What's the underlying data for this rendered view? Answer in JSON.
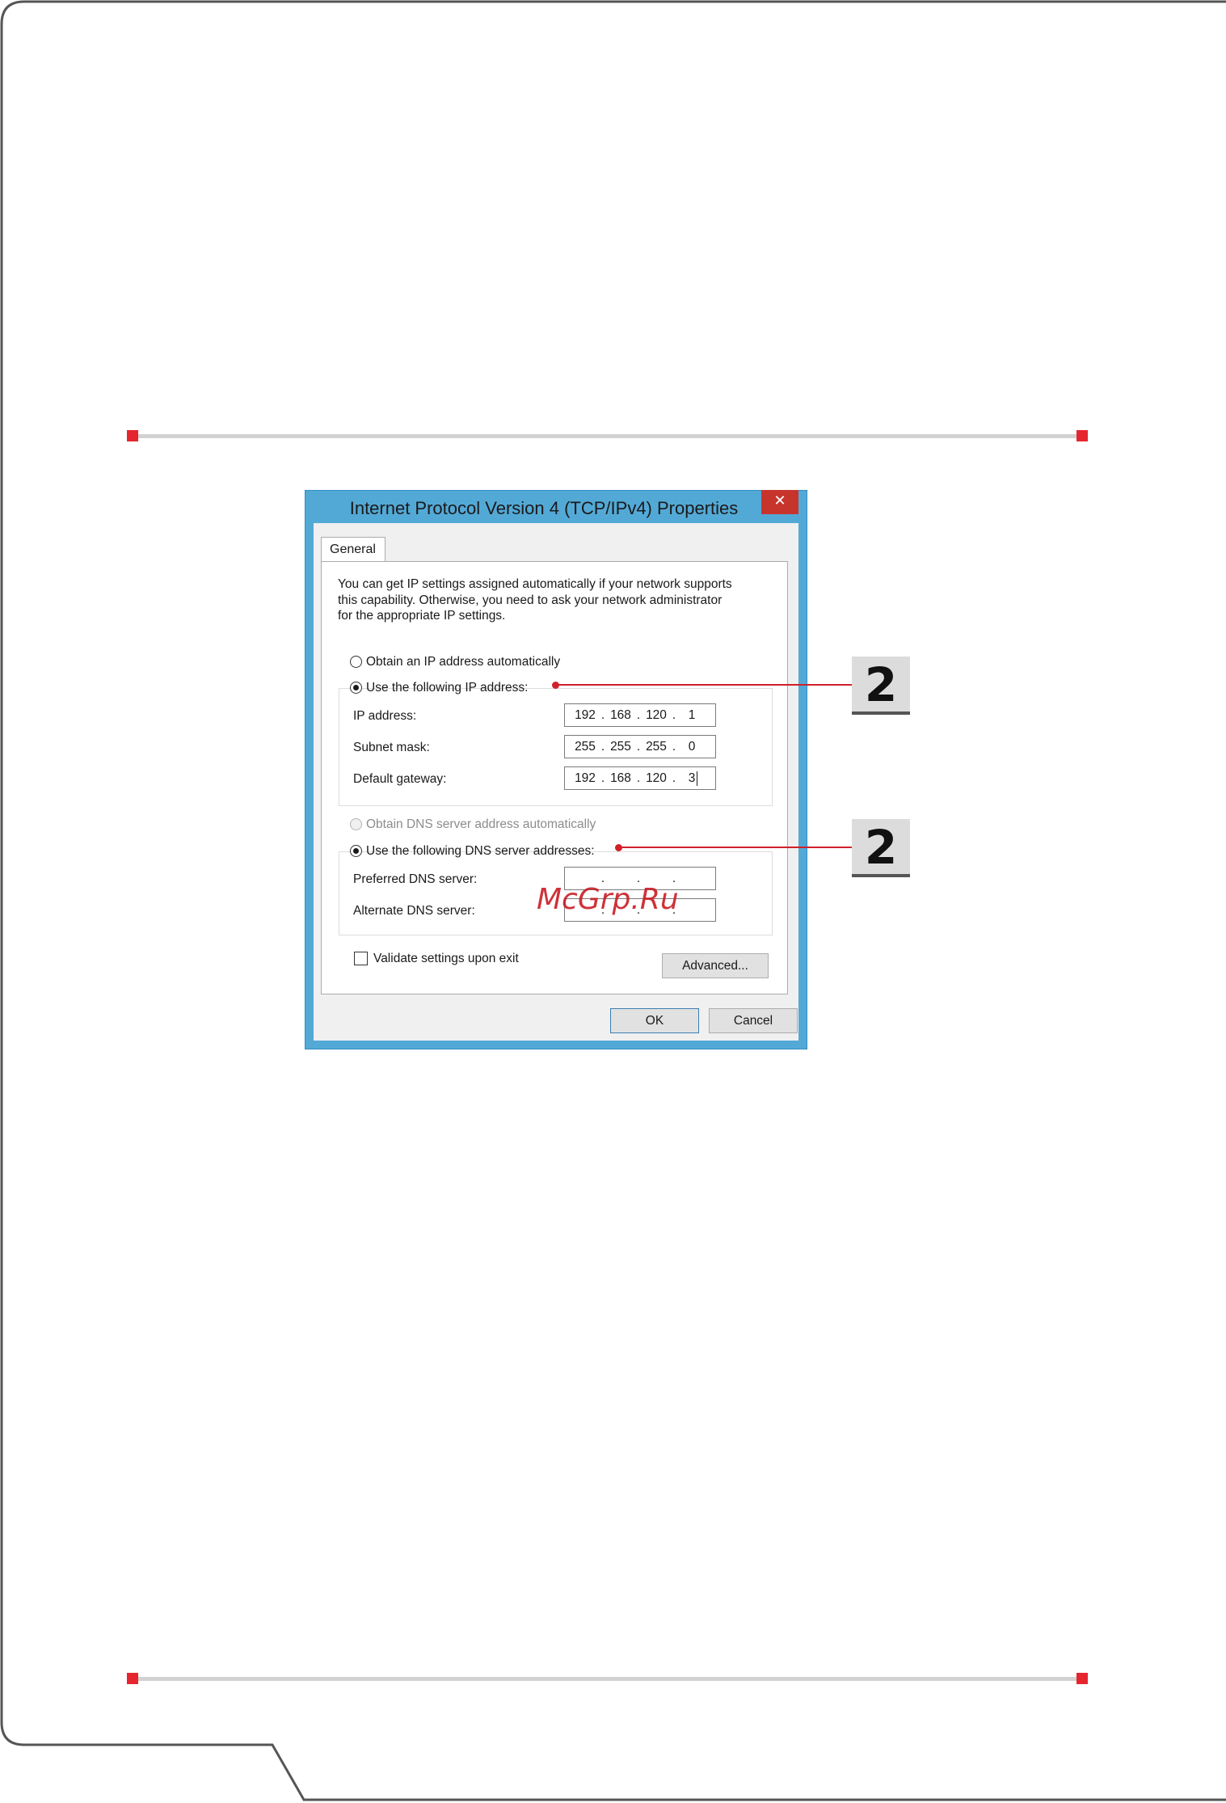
{
  "dialog": {
    "title": "Internet Protocol Version 4 (TCP/IPv4) Properties",
    "close_icon": "close-icon",
    "tab_label": "General",
    "intro_lines": [
      "You can get IP settings assigned automatically if your network supports",
      "this capability. Otherwise, you need to ask your network administrator",
      "for the appropriate IP settings."
    ],
    "ip_options": {
      "auto_label": "Obtain an IP address automatically",
      "manual_label": "Use the following IP address:",
      "selected": "manual"
    },
    "ip_fields": [
      {
        "label": "IP address:",
        "octets": [
          "192",
          "168",
          "120",
          "1"
        ]
      },
      {
        "label": "Subnet mask:",
        "octets": [
          "255",
          "255",
          "255",
          "0"
        ]
      },
      {
        "label": "Default gateway:",
        "octets": [
          "192",
          "168",
          "120",
          "3"
        ]
      }
    ],
    "dns_options": {
      "auto_label": "Obtain DNS server address automatically",
      "manual_label": "Use the following DNS server addresses:",
      "selected": "manual",
      "auto_disabled": true
    },
    "dns_fields": [
      {
        "label": "Preferred DNS server:",
        "octets": [
          "",
          "",
          "",
          ""
        ]
      },
      {
        "label": "Alternate DNS server:",
        "octets": [
          "",
          "",
          "",
          ""
        ]
      }
    ],
    "validate_label": "Validate settings upon exit",
    "validate_checked": false,
    "advanced_label": "Advanced...",
    "ok_label": "OK",
    "cancel_label": "Cancel"
  },
  "callouts": [
    {
      "number": "2",
      "target": "Use the following IP address"
    },
    {
      "number": "2",
      "target": "Use the following DNS server addresses"
    }
  ],
  "watermark": "McGrp.Ru",
  "colors": {
    "accent_red": "#e5262e",
    "callout_red": "#d0202a",
    "dialog_frame": "#53a9d6",
    "close_button": "#c7342c",
    "rule_gray": "#d2d2d2"
  }
}
